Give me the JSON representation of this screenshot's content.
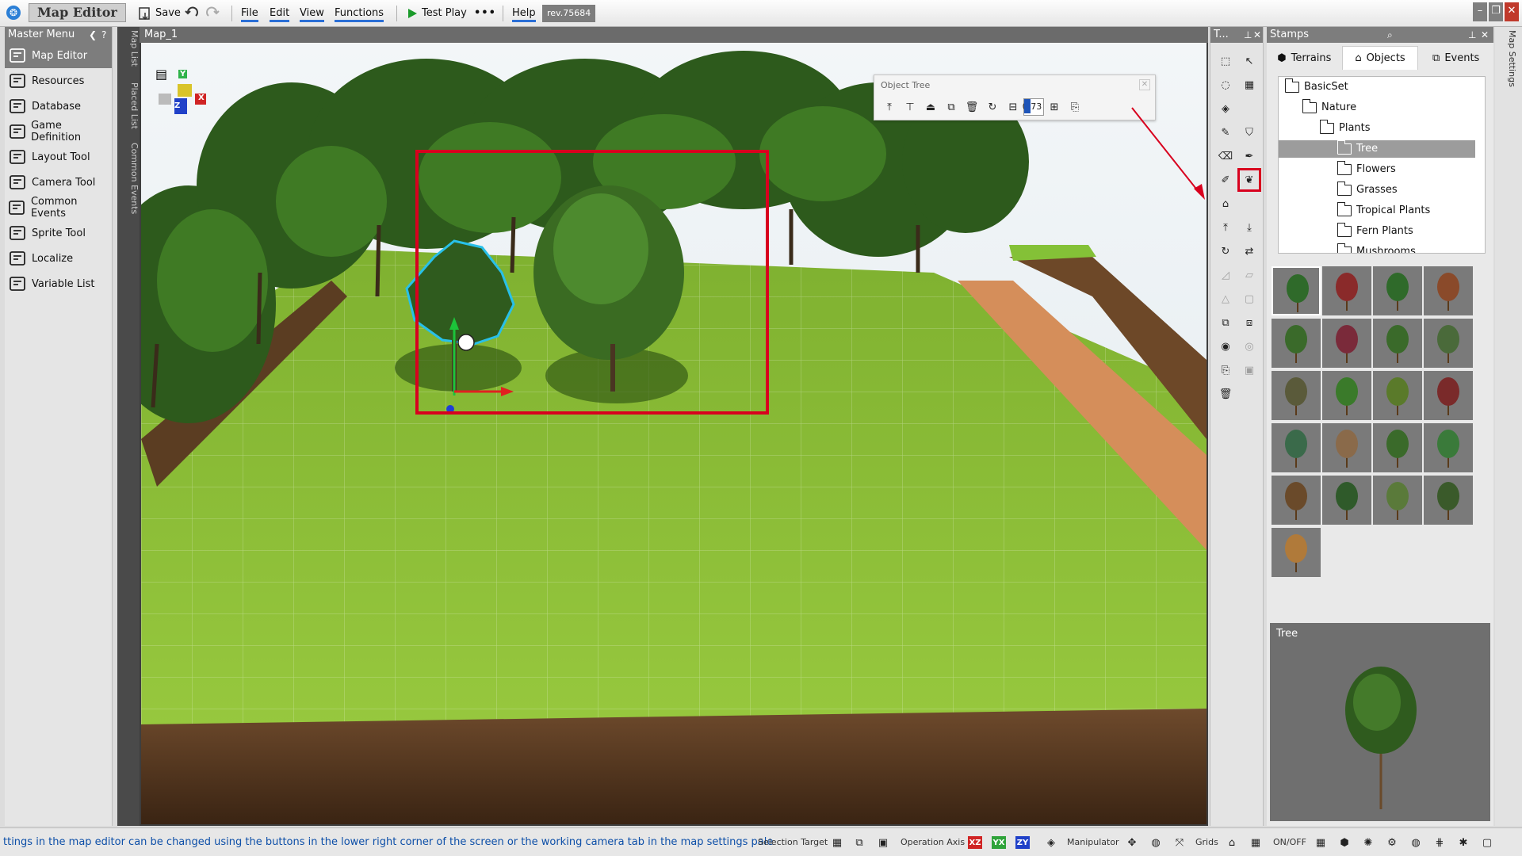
{
  "app": {
    "title": "Map Editor",
    "revision": "rev.75684"
  },
  "toolbar": {
    "save": "Save",
    "file": "File",
    "edit": "Edit",
    "view": "View",
    "functions": "Functions",
    "test_play": "Test Play",
    "help": "Help"
  },
  "master_menu": {
    "title": "Master Menu",
    "items": [
      {
        "label": "Map Editor",
        "icon": "map-editor-icon",
        "active": true
      },
      {
        "label": "Resources",
        "icon": "resources-icon"
      },
      {
        "label": "Database",
        "icon": "database-icon"
      },
      {
        "label": "Game Definition",
        "icon": "game-definition-icon"
      },
      {
        "label": "Layout Tool",
        "icon": "layout-tool-icon"
      },
      {
        "label": "Camera Tool",
        "icon": "camera-tool-icon"
      },
      {
        "label": "Common Events",
        "icon": "common-events-icon"
      },
      {
        "label": "Sprite Tool",
        "icon": "sprite-tool-icon"
      },
      {
        "label": "Localize",
        "icon": "localize-icon"
      },
      {
        "label": "Variable List",
        "icon": "variable-list-icon"
      }
    ]
  },
  "side_tabs": {
    "map_list": "Map List",
    "placed_list": "Placed List",
    "common_events": "Common Events",
    "map_settings": "Map Settings"
  },
  "map": {
    "tab": "Map_1",
    "gizmo": {
      "y": "Y",
      "z": "Z",
      "x": "X"
    }
  },
  "object_tree": {
    "title": "Object Tree",
    "value": "0.73"
  },
  "tool_panel": {
    "title": "T..."
  },
  "stamps": {
    "title": "Stamps",
    "tabs": [
      "Terrains",
      "Objects",
      "Events"
    ],
    "tree": [
      {
        "label": "BasicSet",
        "level": 0
      },
      {
        "label": "Nature",
        "level": 1
      },
      {
        "label": "Plants",
        "level": 2
      },
      {
        "label": "Tree",
        "level": 3,
        "selected": true
      },
      {
        "label": "Flowers",
        "level": 3
      },
      {
        "label": "Grasses",
        "level": 3
      },
      {
        "label": "Tropical Plants",
        "level": 3
      },
      {
        "label": "Fern Plants",
        "level": 3
      },
      {
        "label": "Mushrooms",
        "level": 3
      }
    ],
    "preview_title": "Tree"
  },
  "status": {
    "text": "ttings in the map editor can be changed using the buttons in the lower right corner of the screen or the working camera tab in the map settings pale",
    "selection_target": "Selection Target",
    "operation_axis": "Operation Axis",
    "axis_xz": "XZ",
    "axis_yx": "YX",
    "axis_zy": "ZY",
    "manipulator": "Manipulator",
    "grids": "Grids",
    "on_off": "ON/OFF"
  },
  "colors": {
    "accent_red": "#d8001e",
    "selection_blue": "#1f55b8",
    "grass": "#8cc03a"
  }
}
